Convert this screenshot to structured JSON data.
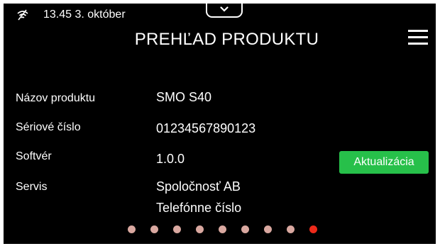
{
  "status": {
    "time_date": "13.45 3. október",
    "signal_icon": "no-connection-icon"
  },
  "header": {
    "title": "PREHĽAD PRODUKTU",
    "menu_icon": "hamburger-menu-icon",
    "handle_icon": "chevron-down-icon"
  },
  "info": {
    "product_name_label": "Názov produktu",
    "product_name_value": "SMO S40",
    "serial_label": "Sériové číslo",
    "serial_value": "01234567890123",
    "software_label": "Softvér",
    "software_value": "1.0.0",
    "service_label": "Servis",
    "service_company": "Spoločnosť AB",
    "service_phone": "Telefónne číslo"
  },
  "update_button": {
    "label": "Aktualizácia"
  },
  "pagination": {
    "total": 9,
    "active_index": 8
  },
  "colors": {
    "background": "#000000",
    "text": "#ffffff",
    "accent_green": "#27c04a",
    "dot_inactive": "#d9a8a0",
    "dot_active": "#ee2a1a"
  }
}
